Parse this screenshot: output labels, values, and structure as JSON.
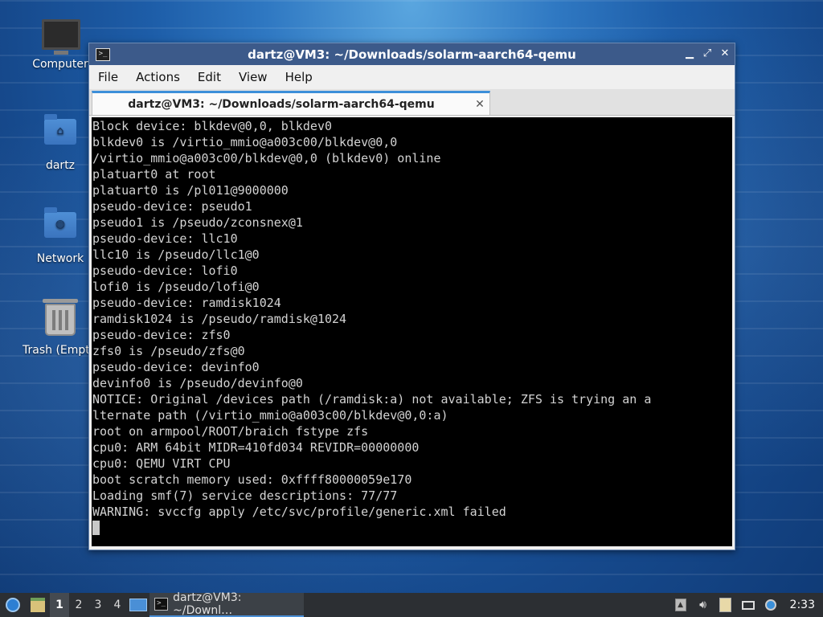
{
  "desktop": {
    "icons": [
      {
        "label": "Computer"
      },
      {
        "label": "dartz"
      },
      {
        "label": "Network"
      },
      {
        "label": "Trash (Empty)"
      }
    ]
  },
  "window": {
    "title": "dartz@VM3: ~/Downloads/solarm-aarch64-qemu",
    "controls": {
      "minimize": "▁",
      "maximize": "⤢",
      "close": "✕"
    },
    "menu": [
      "File",
      "Actions",
      "Edit",
      "View",
      "Help"
    ],
    "tab": {
      "label": "dartz@VM3: ~/Downloads/solarm-aarch64-qemu",
      "close": "✕"
    },
    "terminal_lines": [
      "Block device: blkdev@0,0, blkdev0",
      "blkdev0 is /virtio_mmio@a003c00/blkdev@0,0",
      "/virtio_mmio@a003c00/blkdev@0,0 (blkdev0) online",
      "platuart0 at root",
      "platuart0 is /pl011@9000000",
      "pseudo-device: pseudo1",
      "pseudo1 is /pseudo/zconsnex@1",
      "pseudo-device: llc10",
      "llc10 is /pseudo/llc1@0",
      "pseudo-device: lofi0",
      "lofi0 is /pseudo/lofi@0",
      "pseudo-device: ramdisk1024",
      "ramdisk1024 is /pseudo/ramdisk@1024",
      "pseudo-device: zfs0",
      "zfs0 is /pseudo/zfs@0",
      "pseudo-device: devinfo0",
      "devinfo0 is /pseudo/devinfo@0",
      "NOTICE: Original /devices path (/ramdisk:a) not available; ZFS is trying an a",
      "lternate path (/virtio_mmio@a003c00/blkdev@0,0:a)",
      "root on armpool/ROOT/braich fstype zfs",
      "cpu0: ARM 64bit MIDR=410fd034 REVIDR=00000000",
      "cpu0: QEMU VIRT CPU",
      "boot scratch memory used: 0xffff80000059e170",
      "Loading smf(7) service descriptions: 77/77",
      "WARNING: svccfg apply /etc/svc/profile/generic.xml failed"
    ]
  },
  "taskbar": {
    "workspaces": [
      "1",
      "2",
      "3",
      "4"
    ],
    "active_workspace": "1",
    "task_label": "dartz@VM3: ~/Downl…",
    "clock": "2:33"
  }
}
